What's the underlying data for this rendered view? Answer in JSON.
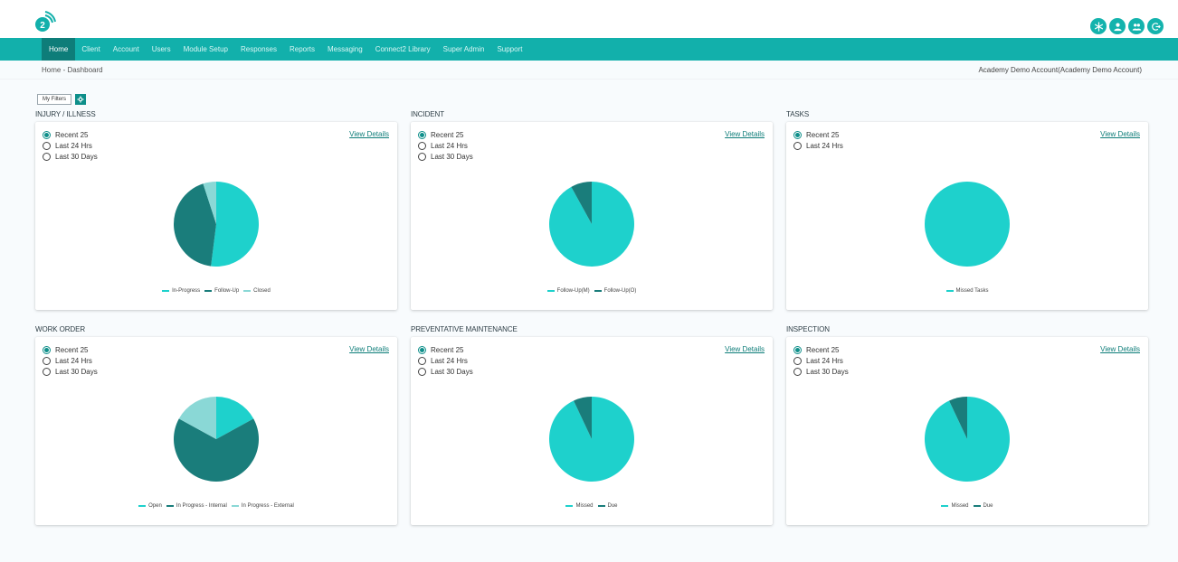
{
  "nav": {
    "items": [
      "Home",
      "Client",
      "Account",
      "Users",
      "Module Setup",
      "Responses",
      "Reports",
      "Messaging",
      "Connect2 Library",
      "Super Admin",
      "Support"
    ],
    "active": "Home"
  },
  "breadcrumb": "Home - Dashboard",
  "account": "Academy Demo Account(Academy Demo Account)",
  "filters": {
    "label": "My Filters"
  },
  "icons": {
    "logo": "connect2-logo-icon",
    "top": [
      "snowflake-icon",
      "user-icon",
      "users-icon",
      "logout-icon"
    ]
  },
  "colors": {
    "accent": "#12b0ab",
    "nav_active": "#0e7d79",
    "pie_primary": "#1ed1cc",
    "pie_dark": "#1a7d7b",
    "pie_light": "#8ad8d6"
  },
  "view_details_label": "View Details",
  "widgets": [
    {
      "title": "INJURY / ILLNESS",
      "options": [
        "Recent 25",
        "Last 24 Hrs",
        "Last 30 Days"
      ],
      "selected": 0,
      "chart_data": {
        "type": "pie",
        "labels": [
          "In-Progress",
          "Follow-Up",
          "Closed"
        ],
        "values": [
          52,
          43,
          5
        ],
        "colors": [
          "#1ed1cc",
          "#1a7d7b",
          "#8ad8d6"
        ]
      }
    },
    {
      "title": "INCIDENT",
      "options": [
        "Recent 25",
        "Last 24 Hrs",
        "Last 30 Days"
      ],
      "selected": 0,
      "chart_data": {
        "type": "pie",
        "labels": [
          "Follow-Up(M)",
          "Follow-Up(O)"
        ],
        "values": [
          92,
          8
        ],
        "colors": [
          "#1ed1cc",
          "#1a7d7b"
        ]
      }
    },
    {
      "title": "TASKS",
      "options": [
        "Recent 25",
        "Last 24 Hrs"
      ],
      "selected": 0,
      "chart_data": {
        "type": "pie",
        "labels": [
          "Missed Tasks"
        ],
        "values": [
          100
        ],
        "colors": [
          "#1ed1cc"
        ]
      }
    },
    {
      "title": "WORK ORDER",
      "options": [
        "Recent 25",
        "Last 24 Hrs",
        "Last 30 Days"
      ],
      "selected": 0,
      "chart_data": {
        "type": "pie",
        "labels": [
          "Open",
          "In Progress - Internal",
          "In Progress - External"
        ],
        "values": [
          17,
          66,
          17
        ],
        "colors": [
          "#1ed1cc",
          "#1a7d7b",
          "#8ad8d6"
        ]
      }
    },
    {
      "title": "PREVENTATIVE MAINTENANCE",
      "options": [
        "Recent 25",
        "Last 24 Hrs",
        "Last 30 Days"
      ],
      "selected": 0,
      "chart_data": {
        "type": "pie",
        "labels": [
          "Missed",
          "Due"
        ],
        "values": [
          93,
          7
        ],
        "colors": [
          "#1ed1cc",
          "#1a7d7b"
        ]
      }
    },
    {
      "title": "INSPECTION",
      "options": [
        "Recent 25",
        "Last 24 Hrs",
        "Last 30 Days"
      ],
      "selected": 0,
      "chart_data": {
        "type": "pie",
        "labels": [
          "Missed",
          "Due"
        ],
        "values": [
          93,
          7
        ],
        "colors": [
          "#1ed1cc",
          "#1a7d7b"
        ]
      }
    }
  ]
}
